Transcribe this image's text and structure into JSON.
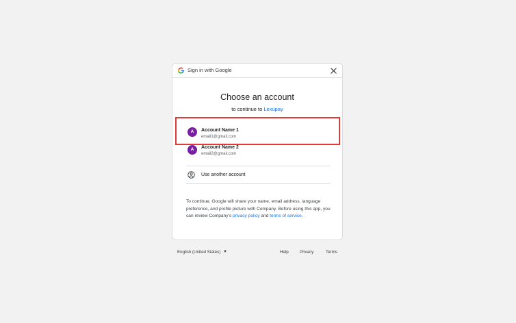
{
  "header": {
    "title": "Sign in with Google",
    "close_icon": "close-icon",
    "logo_icon": "google-g-icon"
  },
  "main": {
    "title": "Choose an account",
    "subtitle_prefix": "to continue to ",
    "app_name": "Lexupay"
  },
  "accounts": [
    {
      "initial": "A",
      "name": "Account Name 1",
      "email": "email1@gmail.com",
      "highlighted": true
    },
    {
      "initial": "A",
      "name": "Account Name 2",
      "email": "email2@gmail.com",
      "highlighted": false
    }
  ],
  "use_another": {
    "label": "Use another account",
    "icon": "person-circle-icon"
  },
  "consent": {
    "text": "To continue, Google will share your name, email address, language preference, and profile picture with Company. Before using this app, you can review Company's ",
    "privacy_link": "privacy policy",
    "and_text": " and ",
    "terms_link": "terms of service",
    "end_text": "."
  },
  "footer": {
    "language": "English (United States)",
    "help": "Help",
    "privacy": "Privacy",
    "terms": "Terms"
  },
  "colors": {
    "avatar": "#7b1fa2",
    "link": "#1a73e8",
    "highlight": "#e53935",
    "background": "#f2f2f2"
  }
}
